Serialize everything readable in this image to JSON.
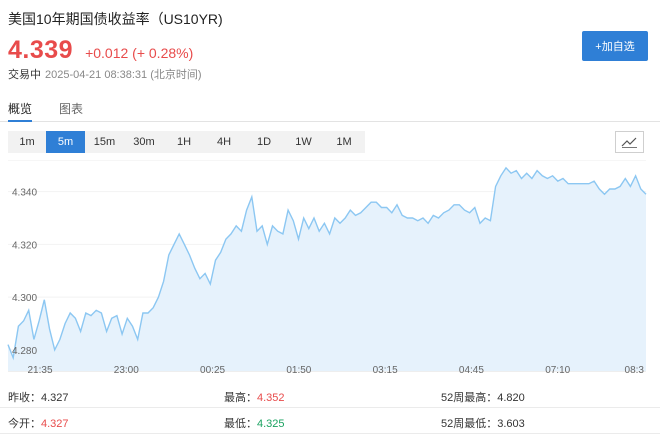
{
  "header": {
    "title": "美国10年期国债收益率（US10YR)",
    "price": "4.339",
    "change": "+0.012 (+ 0.28%)",
    "status": "交易中",
    "timestamp": "2025-04-21 08:38:31 (北京时间)",
    "add_button_label": "+加自选"
  },
  "tabs": [
    "概览",
    "图表"
  ],
  "periods": [
    "1m",
    "5m",
    "15m",
    "30m",
    "1H",
    "4H",
    "1D",
    "1W",
    "1M"
  ],
  "active_period": "5m",
  "colors": {
    "up": "#e84b4b",
    "down": "#1aa260",
    "accent": "#2f7fd6",
    "line": "#8cc7f2",
    "fill": "#e6f2fc"
  },
  "chart_data": {
    "type": "area",
    "ylim": [
      4.272,
      4.352
    ],
    "yticks": [
      "4.340",
      "4.320",
      "4.300",
      "4.280"
    ],
    "xticks": [
      "21:35",
      "23:00",
      "00:25",
      "01:50",
      "03:15",
      "04:45",
      "07:10",
      "08:3"
    ],
    "values": [
      4.282,
      4.277,
      4.289,
      4.291,
      4.295,
      4.284,
      4.291,
      4.299,
      4.288,
      4.28,
      4.284,
      4.29,
      4.294,
      4.292,
      4.287,
      4.294,
      4.293,
      4.295,
      4.294,
      4.287,
      4.292,
      4.293,
      4.286,
      4.292,
      4.289,
      4.284,
      4.294,
      4.294,
      4.296,
      4.3,
      4.306,
      4.316,
      4.32,
      4.324,
      4.32,
      4.316,
      4.311,
      4.307,
      4.309,
      4.305,
      4.314,
      4.317,
      4.322,
      4.324,
      4.327,
      4.325,
      4.333,
      4.338,
      4.325,
      4.327,
      4.32,
      4.327,
      4.325,
      4.324,
      4.333,
      4.329,
      4.322,
      4.33,
      4.326,
      4.33,
      4.325,
      4.328,
      4.324,
      4.33,
      4.328,
      4.33,
      4.333,
      4.331,
      4.332,
      4.334,
      4.336,
      4.336,
      4.334,
      4.334,
      4.332,
      4.335,
      4.331,
      4.33,
      4.33,
      4.329,
      4.33,
      4.328,
      4.331,
      4.33,
      4.332,
      4.333,
      4.335,
      4.335,
      4.333,
      4.332,
      4.334,
      4.328,
      4.33,
      4.329,
      4.342,
      4.346,
      4.349,
      4.347,
      4.348,
      4.345,
      4.347,
      4.345,
      4.348,
      4.346,
      4.345,
      4.346,
      4.344,
      4.345,
      4.343,
      4.343,
      4.343,
      4.343,
      4.343,
      4.344,
      4.341,
      4.339,
      4.341,
      4.341,
      4.342,
      4.345,
      4.342,
      4.346,
      4.341,
      4.339
    ]
  },
  "stats": [
    [
      {
        "label": "昨收：",
        "value": "4.327",
        "tone": "neutral"
      },
      {
        "label": "最高：",
        "value": "4.352",
        "tone": "up"
      },
      {
        "label": "52周最高：",
        "value": "4.820",
        "tone": "neutral"
      }
    ],
    [
      {
        "label": "今开：",
        "value": "4.327",
        "tone": "up"
      },
      {
        "label": "最低：",
        "value": "4.325",
        "tone": "down"
      },
      {
        "label": "52周最低：",
        "value": "3.603",
        "tone": "neutral"
      }
    ]
  ]
}
